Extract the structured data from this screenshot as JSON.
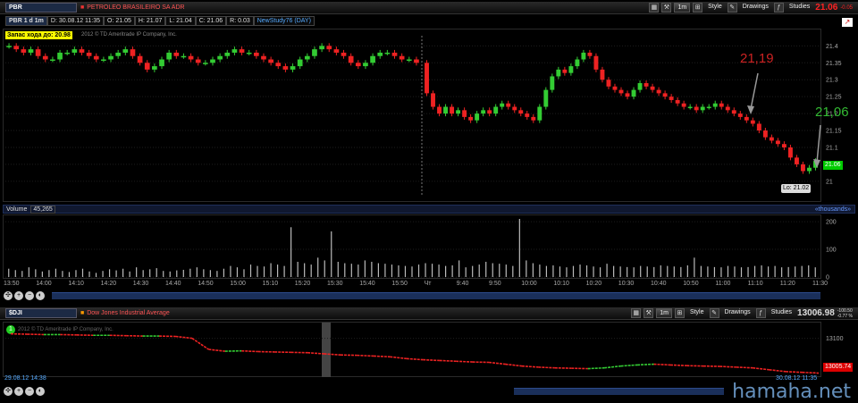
{
  "top": {
    "symbol": "PBR",
    "company": "PETROLEO BRASILEIRO SA ADR",
    "timeframe": "1m",
    "style": "Style",
    "drawings": "Drawings",
    "studies": "Studies",
    "last": "21.06",
    "change": "-0.05"
  },
  "info": {
    "period": "PBR 1 d 1m",
    "date": "D: 30.08.12 11:35",
    "open": "O: 21.05",
    "high": "H: 21.07",
    "low": "L: 21.04",
    "close": "C: 21.06",
    "range": "R: 0.03",
    "study": "NewStudy76 (DAY)"
  },
  "badge": {
    "text": "Запас хода до: 20.98",
    "copyright": "2012 © TD Ameritrade IP Company, Inc."
  },
  "annot": {
    "a1": "21,19",
    "a2": "21,06"
  },
  "price_labels": {
    "last": "21.06",
    "low": "Lo: 21.02"
  },
  "volume": {
    "label": "Volume",
    "value": "45,265",
    "units": "«thousands»"
  },
  "time_ticks": [
    "13:50",
    "14:00",
    "14:10",
    "14:20",
    "14:30",
    "14:40",
    "14:50",
    "15:00",
    "15:10",
    "15:20",
    "15:30",
    "15:40",
    "15:50",
    "Чт",
    "9:40",
    "9:50",
    "10:00",
    "10:10",
    "10:20",
    "10:30",
    "10:40",
    "10:50",
    "11:00",
    "11:10",
    "11:20",
    "11:30"
  ],
  "dji": {
    "symbol": "$DJI",
    "name": "Dow Jones Industrial Average",
    "last": "13006.98",
    "change": "-100.50",
    "pct": "-0.77 %",
    "price_label": "13005.74",
    "start": "29.08.12 14:38",
    "end": "30.08.12 11:35",
    "copyright": "2012 © TD Ameritrade IP Company, Inc."
  },
  "watermark": "hamaha.net",
  "chart_data": [
    {
      "type": "candlestick",
      "title": "PBR 1 d 1m",
      "ylim": [
        20.96,
        21.43
      ],
      "yticks": [
        21.4,
        21.35,
        21.3,
        21.25,
        21.2,
        21.15,
        21.1,
        21.05,
        21.0
      ],
      "series": [
        {
          "session": "prior",
          "close": [
            21.4,
            21.39,
            21.38,
            21.39,
            21.37,
            21.36,
            21.36,
            21.38,
            21.38,
            21.39,
            21.38,
            21.37,
            21.36,
            21.36,
            21.37,
            21.38,
            21.39,
            21.37,
            21.35,
            21.33,
            21.34,
            21.36,
            21.38,
            21.37,
            21.37,
            21.36,
            21.35,
            21.35,
            21.36,
            21.37,
            21.38,
            21.39,
            21.38,
            21.38,
            21.37,
            21.36,
            21.35,
            21.34,
            21.33,
            21.34,
            21.36,
            21.37,
            21.39,
            21.4,
            21.39,
            21.38,
            21.37,
            21.35,
            21.34,
            21.35,
            21.37,
            21.38,
            21.38,
            21.37,
            21.36,
            21.36,
            21.35
          ]
        },
        {
          "session": "current",
          "close": [
            21.26,
            21.22,
            21.2,
            21.22,
            21.2,
            21.21,
            21.19,
            21.18,
            21.2,
            21.21,
            21.2,
            21.22,
            21.23,
            21.22,
            21.21,
            21.2,
            21.19,
            21.18,
            21.22,
            21.27,
            21.31,
            21.33,
            21.32,
            21.34,
            21.36,
            21.38,
            21.37,
            21.33,
            21.3,
            21.28,
            21.27,
            21.26,
            21.25,
            21.27,
            21.29,
            21.28,
            21.27,
            21.26,
            21.25,
            21.24,
            21.23,
            21.22,
            21.22,
            21.21,
            21.22,
            21.22,
            21.23,
            21.22,
            21.21,
            21.2,
            21.19,
            21.18,
            21.17,
            21.15,
            21.13,
            21.12,
            21.11,
            21.1,
            21.07,
            21.05,
            21.03,
            21.04,
            21.06
          ]
        }
      ]
    },
    {
      "type": "bar",
      "title": "Volume",
      "ylim": [
        0,
        210
      ],
      "yticks": [
        200,
        100,
        0
      ],
      "units": "thousands",
      "values": [
        30,
        25,
        22,
        35,
        28,
        20,
        25,
        30,
        22,
        18,
        25,
        30,
        20,
        15,
        22,
        28,
        24,
        30,
        20,
        35,
        25,
        28,
        32,
        22,
        20,
        24,
        26,
        30,
        35,
        28,
        25,
        22,
        30,
        40,
        35,
        28,
        45,
        40,
        38,
        50,
        45,
        40,
        180,
        55,
        50,
        45,
        70,
        60,
        165,
        55,
        50,
        48,
        45,
        60,
        55,
        50,
        48,
        45,
        42,
        40,
        38,
        45,
        50,
        48,
        45,
        40,
        42,
        60,
        35,
        40,
        45,
        55,
        50,
        48,
        45,
        40,
        210,
        60,
        50,
        45,
        40,
        42,
        38,
        35,
        40,
        45,
        42,
        38,
        35,
        48,
        40,
        38,
        36,
        35,
        40,
        38,
        36,
        42,
        40,
        38,
        36,
        42,
        70,
        40,
        38,
        36,
        35,
        40,
        38,
        35,
        36,
        40,
        42,
        38,
        40,
        35,
        36,
        38,
        40,
        42,
        35
      ]
    },
    {
      "type": "line",
      "title": "Dow Jones Industrial Average",
      "ylim": [
        13000,
        13140
      ],
      "yticks": [
        13100
      ],
      "values": [
        13112,
        13111,
        13110,
        13110,
        13109,
        13108,
        13108,
        13107,
        13106,
        13106,
        13105,
        13100,
        13070,
        13065,
        13066,
        13064,
        13063,
        13062,
        13061,
        13058,
        13055,
        13054,
        13052,
        13050,
        13045,
        13042,
        13040,
        13038,
        13036,
        13035,
        13030,
        13025,
        13022,
        13020,
        13019,
        13018,
        13020,
        13025,
        13028,
        13030,
        13028,
        13026,
        13025,
        13024,
        13022,
        13020,
        13015,
        13010,
        13008,
        13006
      ]
    }
  ]
}
